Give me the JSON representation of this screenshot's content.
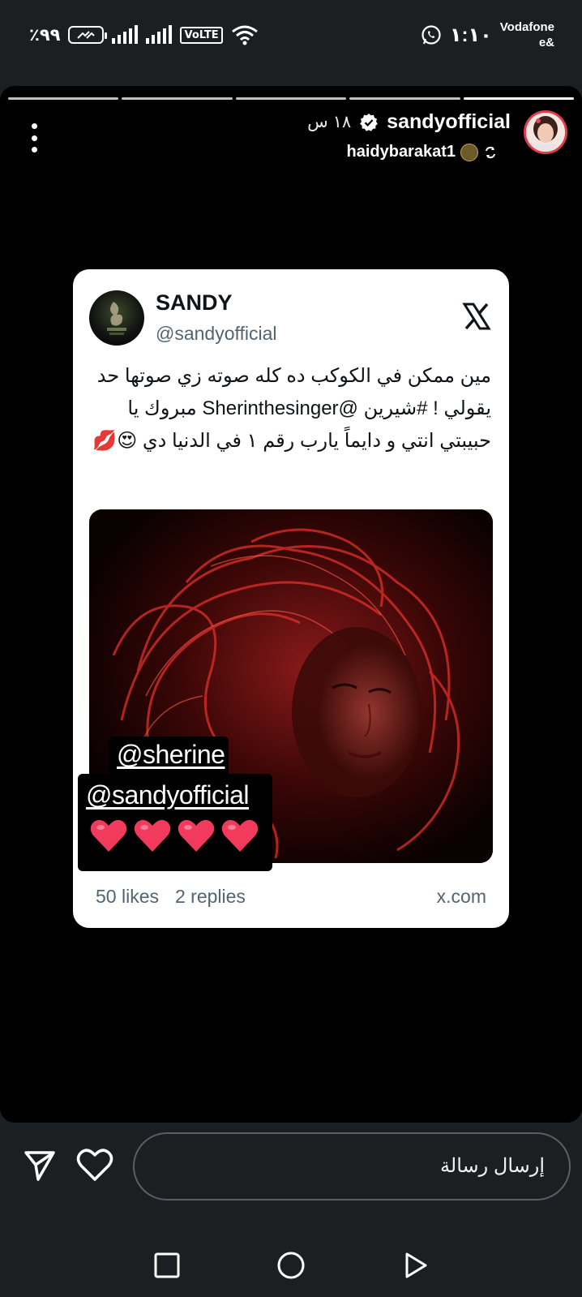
{
  "status_bar": {
    "battery_text": "٪٩٩",
    "time": "١:١٠",
    "carrier_line1": "Vodafone",
    "carrier_line2": "e&",
    "volte_label": "VoLTE",
    "icons": [
      "battery-charging-icon",
      "signal-icon",
      "signal-icon",
      "volte-icon",
      "wifi-icon",
      "whatsapp-icon"
    ]
  },
  "story": {
    "segments": 5,
    "username": "sandyofficial",
    "time_ago": "١٨ س",
    "reposted_from": "haidybarakat1",
    "verified": true
  },
  "tweet": {
    "name": "SANDY",
    "handle": "@sandyofficial",
    "text": "مين ممكن في الكوكب ده كله صوته زي صوتها حد يقولي ! #شيرين @Sherinthesinger مبروك يا حبيبتي انتي و دايماً يارب رقم ١ في الدنيا دي 😍💋",
    "likes": "50 likes",
    "replies": "2 replies",
    "domain": "x.com"
  },
  "sticker": {
    "mention1": "@sherine",
    "mention2": "@sandyofficial",
    "hearts": "❤️❤️❤️❤️"
  },
  "reply_bar": {
    "placeholder": "إرسال رسالة"
  },
  "colors": {
    "accent_heart": "#f23a5c",
    "story_ring": "#e23b4a",
    "background": "#1c1f22"
  }
}
